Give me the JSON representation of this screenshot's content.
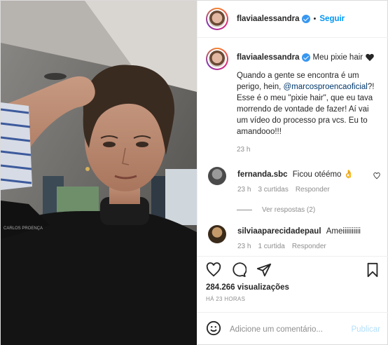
{
  "header": {
    "username": "flaviaalessandra",
    "separator": "•",
    "follow_label": "Seguir"
  },
  "caption": {
    "username": "flaviaalessandra",
    "title": "Meu pixie hair",
    "text_before": "Quando a gente se encontra é um perigo, hein, ",
    "mention": "@marcosproencaoficial",
    "text_after": "?! Esse é o meu \"pixie hair\", que eu tava morrendo de vontade de fazer! Aí vai um vídeo do processo pra vcs. Eu to amandooo!!!",
    "time": "23 h"
  },
  "comments": [
    {
      "username": "fernanda.sbc",
      "text": "Ficou otéémo",
      "time": "23 h",
      "likes": "3 curtidas",
      "reply": "Responder"
    },
    {
      "username": "silviaaparecidadepaul",
      "text": "Ameiiiiiiiiii",
      "time": "23 h",
      "likes": "1 curtida",
      "reply": "Responder"
    }
  ],
  "view_replies": "Ver respostas (2)",
  "stats": {
    "views": "284.266 visualizações",
    "posted": "HÁ 23 HORAS"
  },
  "add_comment": {
    "placeholder": "Adicione um comentário...",
    "publish_label": "Publicar"
  },
  "icons": {
    "verified": "verified-badge-icon",
    "like": "heart-outline-icon",
    "comment": "comment-bubble-icon",
    "share": "paper-plane-icon",
    "save": "bookmark-icon",
    "emoji": "smiley-icon"
  },
  "colors": {
    "link": "#0095f6",
    "verified": "#3897f0",
    "muted": "#8e8e8e",
    "publish_disabled": "#b2dffc"
  }
}
